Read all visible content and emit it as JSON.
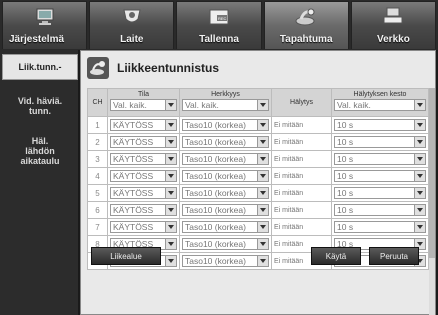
{
  "tabs": [
    {
      "label": "Järjestelmä",
      "icon": "monitor-icon"
    },
    {
      "label": "Laite",
      "icon": "camera-icon"
    },
    {
      "label": "Tallenna",
      "icon": "record-icon"
    },
    {
      "label": "Tapahtuma",
      "icon": "event-icon"
    },
    {
      "label": "Verkko",
      "icon": "network-icon"
    }
  ],
  "sidebar": {
    "items": [
      {
        "label": "Liik.tunn.-"
      },
      {
        "label_1": "Vid. häviä.",
        "label_2": "tunn."
      },
      {
        "label_1": "Häl.",
        "label_2": "lähdön",
        "label_3": "aikataulu"
      }
    ]
  },
  "panel": {
    "title": "Liikkeentunnistus"
  },
  "table": {
    "headers": {
      "ch": "CH",
      "mode": "Tila",
      "sensitivity": "Herkkyys",
      "alarm": "Hälytys",
      "duration": "Hälytyksen kesto"
    },
    "header_selects": {
      "mode": "Val. kaik.",
      "sensitivity": "Val. kaik.",
      "duration": "Val. kaik."
    },
    "rows": [
      {
        "ch": "1",
        "mode": "KÄYTÖSS",
        "sensitivity": "Taso10 (korkea)",
        "alarm": "Ei mitään",
        "duration": "10 s"
      },
      {
        "ch": "2",
        "mode": "KÄYTÖSS",
        "sensitivity": "Taso10 (korkea)",
        "alarm": "Ei mitään",
        "duration": "10 s"
      },
      {
        "ch": "3",
        "mode": "KÄYTÖSS",
        "sensitivity": "Taso10 (korkea)",
        "alarm": "Ei mitään",
        "duration": "10 s"
      },
      {
        "ch": "4",
        "mode": "KÄYTÖSS",
        "sensitivity": "Taso10 (korkea)",
        "alarm": "Ei mitään",
        "duration": "10 s"
      },
      {
        "ch": "5",
        "mode": "KÄYTÖSS",
        "sensitivity": "Taso10 (korkea)",
        "alarm": "Ei mitään",
        "duration": "10 s"
      },
      {
        "ch": "6",
        "mode": "KÄYTÖSS",
        "sensitivity": "Taso10 (korkea)",
        "alarm": "Ei mitään",
        "duration": "10 s"
      },
      {
        "ch": "7",
        "mode": "KÄYTÖSS",
        "sensitivity": "Taso10 (korkea)",
        "alarm": "Ei mitään",
        "duration": "10 s"
      },
      {
        "ch": "8",
        "mode": "KÄYTÖSS",
        "sensitivity": "Taso10 (korkea)",
        "alarm": "Ei mitään",
        "duration": "10 s"
      },
      {
        "ch": "9",
        "mode": "KÄYTÖSS",
        "sensitivity": "Taso10 (korkea)",
        "alarm": "Ei mitään",
        "duration": "10 s"
      }
    ]
  },
  "buttons": {
    "motion_area": "Liikealue",
    "apply": "Käytä",
    "cancel": "Peruuta"
  }
}
